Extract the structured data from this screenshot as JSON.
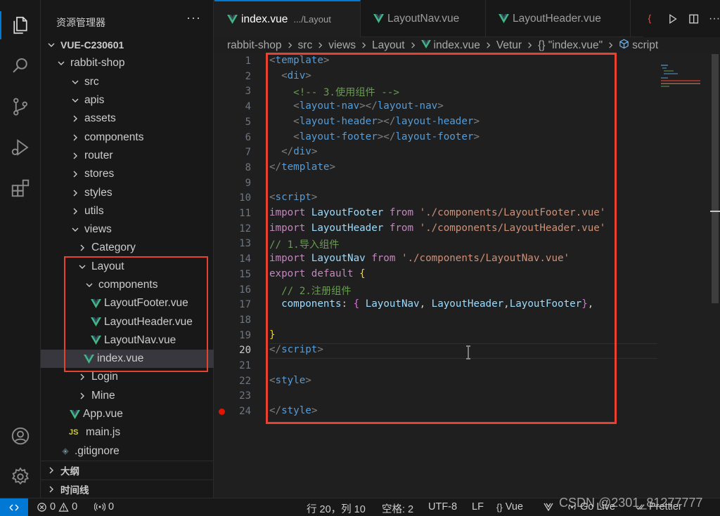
{
  "sidebar": {
    "title": "资源管理器",
    "more": "···",
    "tree": [
      {
        "label": "VUE-C230601",
        "depth": 0,
        "type": "folder",
        "open": true,
        "bold": true
      },
      {
        "label": "rabbit-shop",
        "depth": 1,
        "type": "folder",
        "open": true
      },
      {
        "label": "src",
        "depth": 2,
        "type": "folder",
        "open": true
      },
      {
        "label": "apis",
        "depth": 3,
        "type": "folder",
        "open": true
      },
      {
        "label": "assets",
        "depth": 3,
        "type": "folder",
        "open": false
      },
      {
        "label": "components",
        "depth": 3,
        "type": "folder",
        "open": false
      },
      {
        "label": "router",
        "depth": 3,
        "type": "folder",
        "open": false
      },
      {
        "label": "stores",
        "depth": 3,
        "type": "folder",
        "open": false
      },
      {
        "label": "styles",
        "depth": 3,
        "type": "folder",
        "open": false
      },
      {
        "label": "utils",
        "depth": 3,
        "type": "folder",
        "open": false
      },
      {
        "label": "views",
        "depth": 3,
        "type": "folder",
        "open": true
      },
      {
        "label": "Category",
        "depth": 4,
        "type": "folder",
        "open": false
      },
      {
        "label": "Layout",
        "depth": 4,
        "type": "folder",
        "open": true
      },
      {
        "label": "components",
        "depth": 5,
        "type": "folder",
        "open": true
      },
      {
        "label": "LayoutFooter.vue",
        "depth": 6,
        "type": "vue"
      },
      {
        "label": "LayoutHeader.vue",
        "depth": 6,
        "type": "vue"
      },
      {
        "label": "LayoutNav.vue",
        "depth": 6,
        "type": "vue"
      },
      {
        "label": "index.vue",
        "depth": 5,
        "type": "vue",
        "selected": true
      },
      {
        "label": "Login",
        "depth": 4,
        "type": "folder",
        "open": false
      },
      {
        "label": "Mine",
        "depth": 4,
        "type": "folder",
        "open": false
      },
      {
        "label": "App.vue",
        "depth": 3,
        "type": "vue"
      },
      {
        "label": "main.js",
        "depth": 3,
        "type": "js"
      },
      {
        "label": ".gitignore",
        "depth": 2,
        "type": "git"
      }
    ],
    "js_badge": "JS",
    "sections": [
      {
        "label": "大纲"
      },
      {
        "label": "时间线"
      }
    ]
  },
  "tabs": [
    {
      "label": "index.vue",
      "path": ".../Layout",
      "active": true
    },
    {
      "label": "LayoutNav.vue",
      "active": false
    },
    {
      "label": "LayoutHeader.vue",
      "active": false
    }
  ],
  "breadcrumb": [
    "rabbit-shop",
    "src",
    "views",
    "Layout",
    "index.vue",
    "Vetur",
    "{} \"index.vue\"",
    "script"
  ],
  "code": [
    [
      [
        "t-punc",
        "<"
      ],
      [
        "t-tag",
        "template"
      ],
      [
        "t-punc",
        ">"
      ]
    ],
    [
      [
        "t-plain",
        "  "
      ],
      [
        "t-punc",
        "<"
      ],
      [
        "t-tag",
        "div"
      ],
      [
        "t-punc",
        ">"
      ]
    ],
    [
      [
        "t-plain",
        "    "
      ],
      [
        "t-com",
        "<!-- 3.使用组件 -->"
      ]
    ],
    [
      [
        "t-plain",
        "    "
      ],
      [
        "t-punc",
        "<"
      ],
      [
        "t-tag",
        "layout-nav"
      ],
      [
        "t-punc",
        "></"
      ],
      [
        "t-tag",
        "layout-nav"
      ],
      [
        "t-punc",
        ">"
      ]
    ],
    [
      [
        "t-plain",
        "    "
      ],
      [
        "t-punc",
        "<"
      ],
      [
        "t-tag",
        "layout-header"
      ],
      [
        "t-punc",
        "></"
      ],
      [
        "t-tag",
        "layout-header"
      ],
      [
        "t-punc",
        ">"
      ]
    ],
    [
      [
        "t-plain",
        "    "
      ],
      [
        "t-punc",
        "<"
      ],
      [
        "t-tag",
        "layout-footer"
      ],
      [
        "t-punc",
        "></"
      ],
      [
        "t-tag",
        "layout-footer"
      ],
      [
        "t-punc",
        ">"
      ]
    ],
    [
      [
        "t-plain",
        "  "
      ],
      [
        "t-punc",
        "</"
      ],
      [
        "t-tag",
        "div"
      ],
      [
        "t-punc",
        ">"
      ]
    ],
    [
      [
        "t-punc",
        "</"
      ],
      [
        "t-tag",
        "template"
      ],
      [
        "t-punc",
        ">"
      ]
    ],
    [],
    [
      [
        "t-punc",
        "<"
      ],
      [
        "t-tag",
        "script"
      ],
      [
        "t-punc",
        ">"
      ]
    ],
    [
      [
        "t-kw",
        "import"
      ],
      [
        "t-plain",
        " "
      ],
      [
        "t-var",
        "LayoutFooter"
      ],
      [
        "t-plain",
        " "
      ],
      [
        "t-kw",
        "from"
      ],
      [
        "t-plain",
        " "
      ],
      [
        "t-str",
        "'./components/LayoutFooter.vue'"
      ]
    ],
    [
      [
        "t-kw",
        "import"
      ],
      [
        "t-plain",
        " "
      ],
      [
        "t-var",
        "LayoutHeader"
      ],
      [
        "t-plain",
        " "
      ],
      [
        "t-kw",
        "from"
      ],
      [
        "t-plain",
        " "
      ],
      [
        "t-str",
        "'./components/LayoutHeader.vue'"
      ]
    ],
    [
      [
        "t-com",
        "// 1.导入组件"
      ]
    ],
    [
      [
        "t-kw",
        "import"
      ],
      [
        "t-plain",
        " "
      ],
      [
        "t-var",
        "LayoutNav"
      ],
      [
        "t-plain",
        " "
      ],
      [
        "t-kw",
        "from"
      ],
      [
        "t-plain",
        " "
      ],
      [
        "t-str",
        "'./components/LayoutNav.vue'"
      ]
    ],
    [
      [
        "t-kw",
        "export"
      ],
      [
        "t-plain",
        " "
      ],
      [
        "t-kw",
        "default"
      ],
      [
        "t-plain",
        " "
      ],
      [
        "t-brace",
        "{"
      ]
    ],
    [
      [
        "t-plain",
        "  "
      ],
      [
        "t-com",
        "// 2.注册组件"
      ]
    ],
    [
      [
        "t-plain",
        "  "
      ],
      [
        "t-var",
        "components"
      ],
      [
        "t-plain",
        ": "
      ],
      [
        "t-brace2",
        "{"
      ],
      [
        "t-plain",
        " "
      ],
      [
        "t-var",
        "LayoutNav"
      ],
      [
        "t-plain",
        ", "
      ],
      [
        "t-var",
        "LayoutHeader"
      ],
      [
        "t-plain",
        ","
      ],
      [
        "t-var",
        "LayoutFooter"
      ],
      [
        "t-brace2",
        "}"
      ],
      [
        "t-plain",
        ","
      ]
    ],
    [],
    [
      [
        "t-brace",
        "}"
      ]
    ],
    [
      [
        "t-punc",
        "</"
      ],
      [
        "t-tag",
        "script"
      ],
      [
        "t-punc",
        ">"
      ]
    ],
    [],
    [
      [
        "t-punc",
        "<"
      ],
      [
        "t-tag",
        "style"
      ],
      [
        "t-punc",
        ">"
      ]
    ],
    [],
    [
      [
        "t-punc",
        "</"
      ],
      [
        "t-tag",
        "style"
      ],
      [
        "t-punc",
        ">"
      ]
    ]
  ],
  "current_line": 20,
  "breakpoint_line": 24,
  "status": {
    "errors": "0",
    "warnings": "0",
    "ports": "0",
    "position": "行 20，列 10",
    "spaces": "空格: 2",
    "encoding": "UTF-8",
    "eol": "LF",
    "language": "Vue",
    "golive": "Go Live",
    "prettier": "Prettier"
  },
  "watermark": "CSDN @2301_81277777",
  "colors": {
    "accent": "#0078d4",
    "annotation": "#e8412f",
    "vue": "#41b883"
  }
}
